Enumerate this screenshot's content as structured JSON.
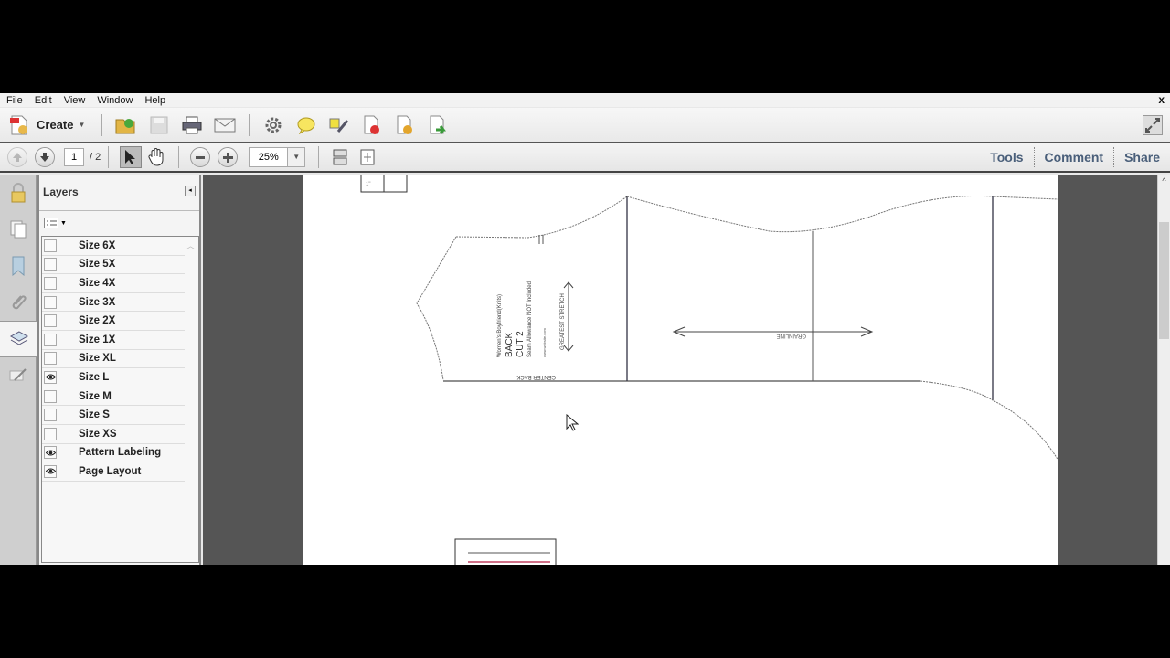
{
  "menu": [
    "File",
    "Edit",
    "View",
    "Window",
    "Help"
  ],
  "window_close": "x",
  "toolbar1": {
    "create_label": "Create",
    "icons": [
      "open-icon",
      "save-icon",
      "print-icon",
      "email-icon",
      "settings-icon",
      "comment-icon",
      "highlight-icon",
      "delete-page-icon",
      "replace-page-icon",
      "export-icon"
    ]
  },
  "toolbar2": {
    "page_current": "1",
    "page_total": "/ 2",
    "zoom_value": "25%",
    "links": [
      "Tools",
      "Comment",
      "Share"
    ]
  },
  "layers_panel": {
    "title": "Layers",
    "collapse_glyph": "◂",
    "layers": [
      {
        "name": "Size 6X",
        "visible": false
      },
      {
        "name": "Size 5X",
        "visible": false
      },
      {
        "name": "Size 4X",
        "visible": false
      },
      {
        "name": "Size 3X",
        "visible": false
      },
      {
        "name": "Size 2X",
        "visible": false
      },
      {
        "name": "Size 1X",
        "visible": false
      },
      {
        "name": "Size XL",
        "visible": false
      },
      {
        "name": "Size L",
        "visible": true
      },
      {
        "name": "Size M",
        "visible": false
      },
      {
        "name": "Size S",
        "visible": false
      },
      {
        "name": "Size XS",
        "visible": false
      },
      {
        "name": "Pattern Labeling",
        "visible": true
      },
      {
        "name": "Page Layout",
        "visible": true
      }
    ]
  },
  "pattern": {
    "label_brand": "Women's Boyfriend(Knits)",
    "label_piece": "BACK",
    "label_cut": "CUT 2",
    "label_seam": "Seam Allowance NOT Included",
    "label_site": "www.website.com",
    "label_stretch": "GREATEST STRETCH",
    "label_center": "CENTER BACK",
    "label_grainline": "GRAINLINE",
    "tile_label": "1\""
  },
  "scrollbar": {
    "up_glyph": "^"
  }
}
